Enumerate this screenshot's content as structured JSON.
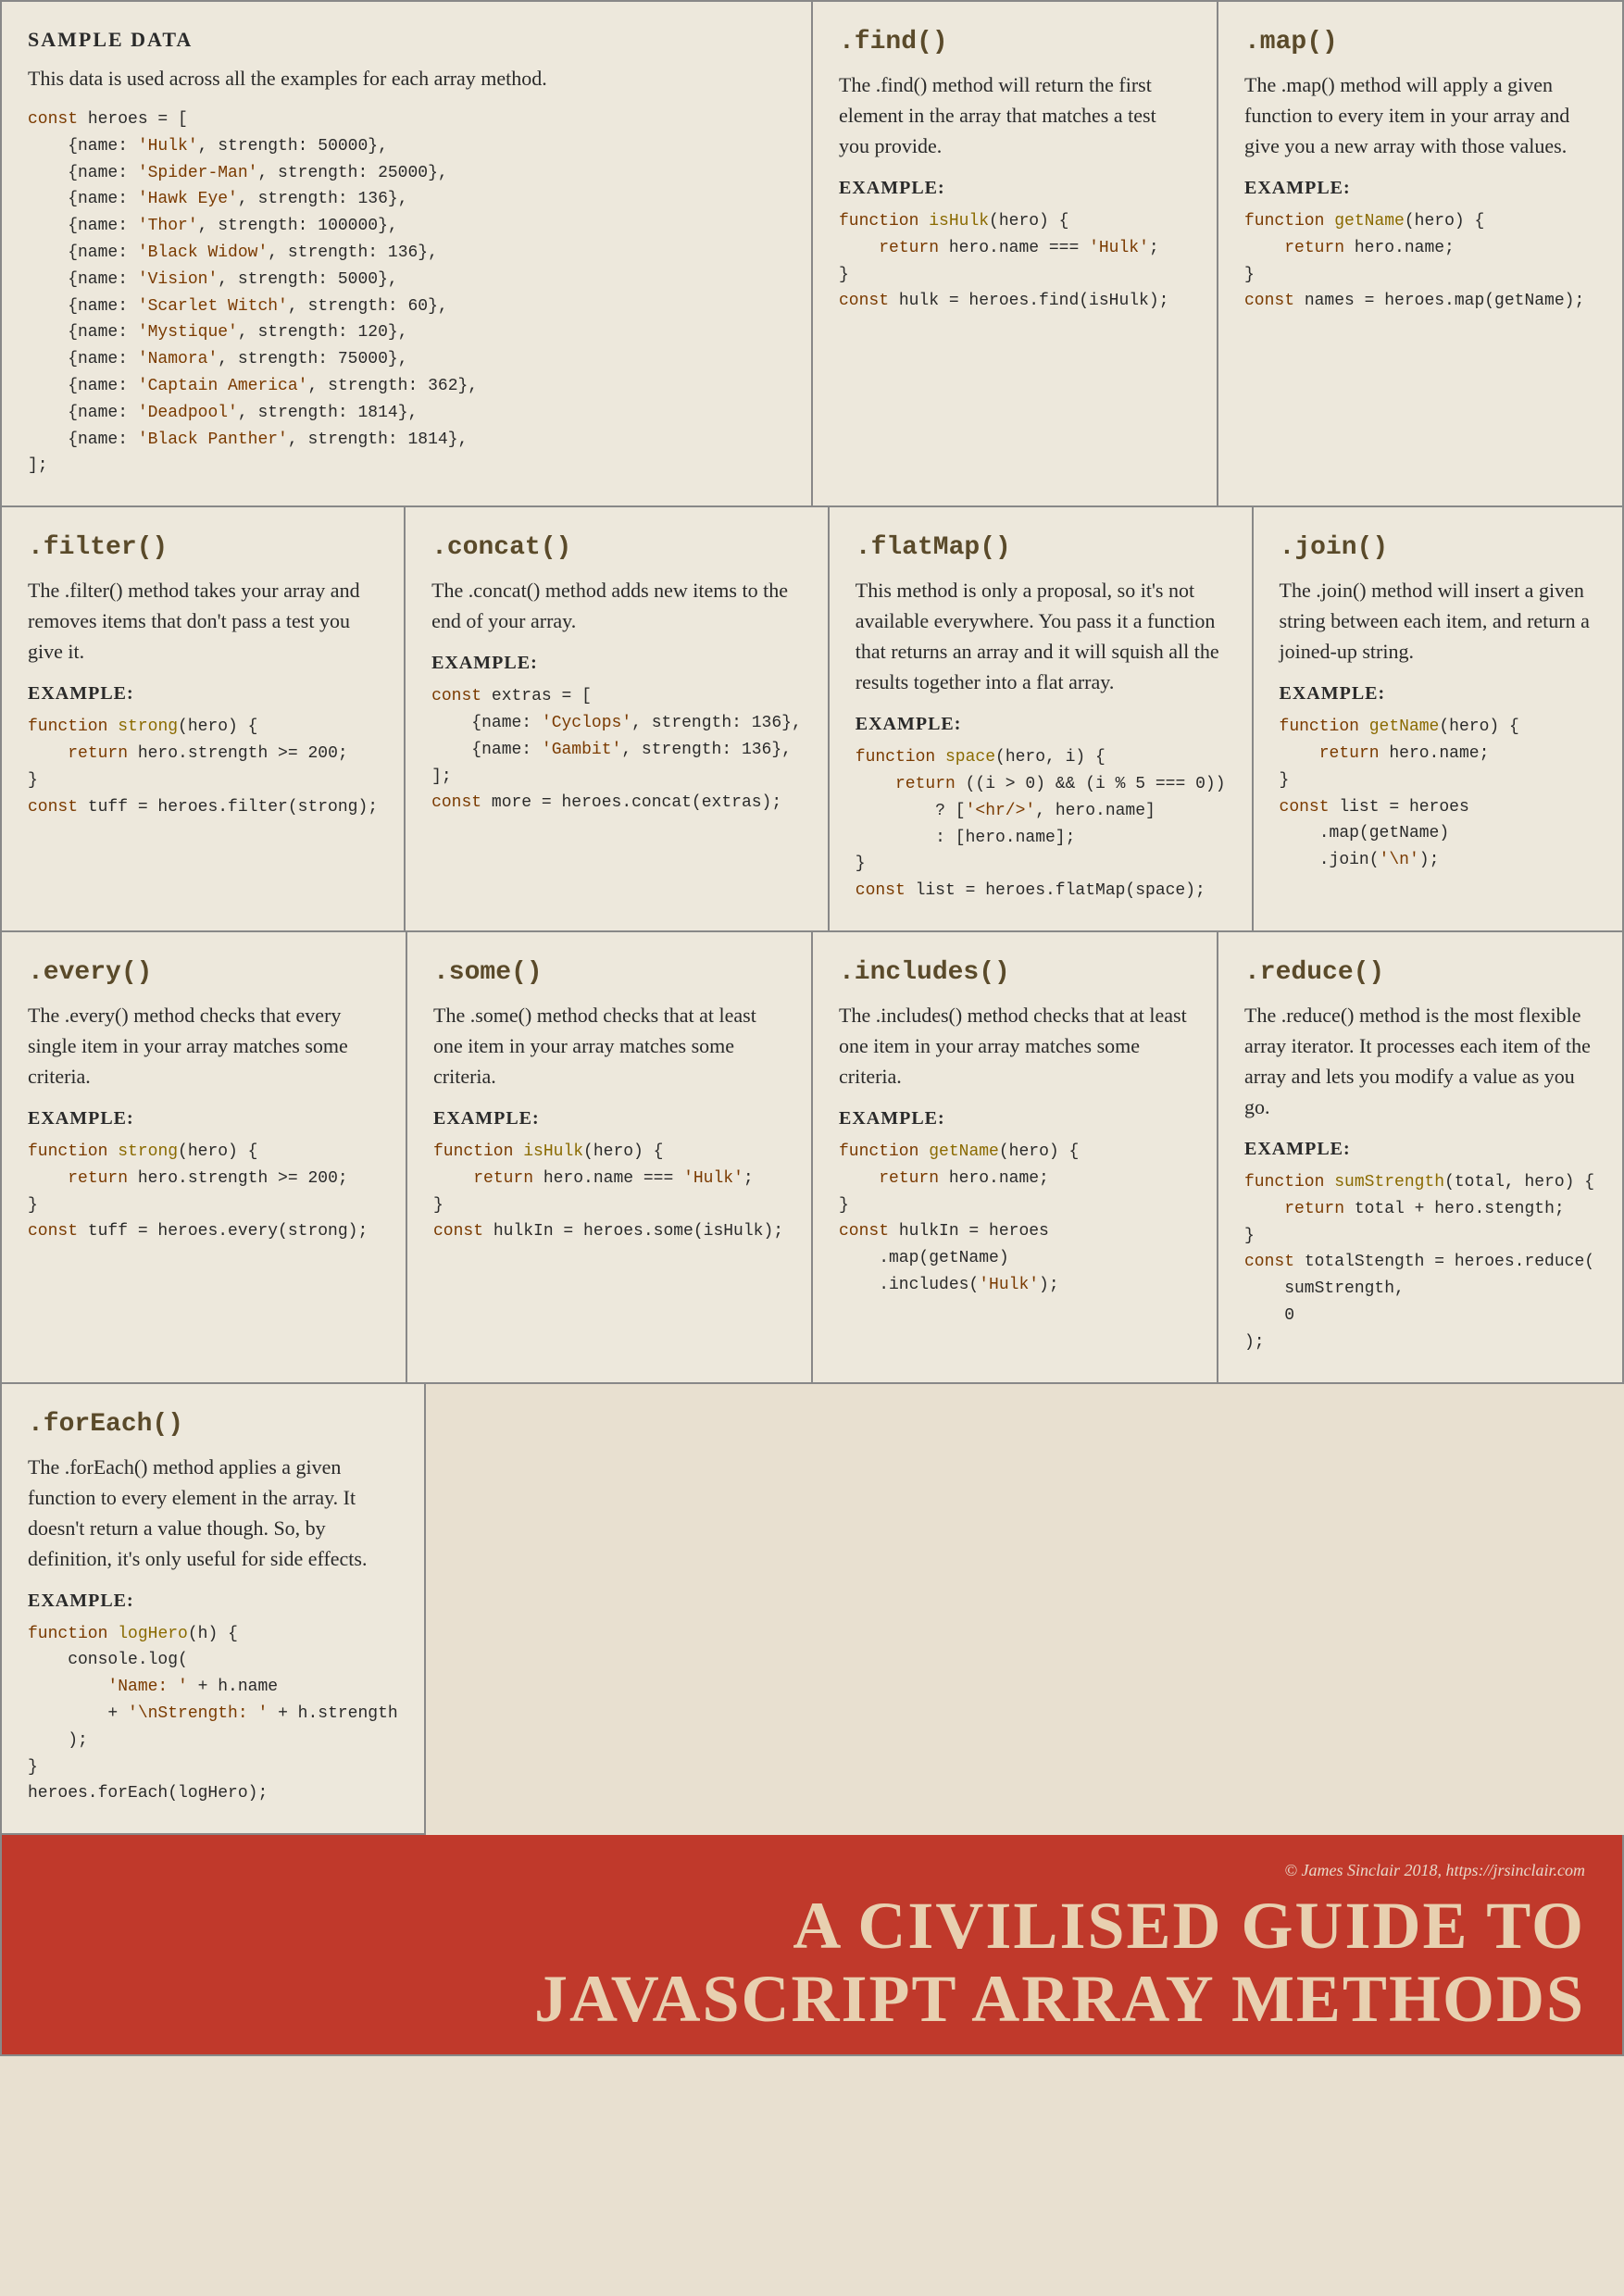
{
  "page": {
    "credit": "© James Sinclair 2018, https://jrsinclair.com",
    "main_title_line1": "A CIVILISED GUIDE TO",
    "main_title_line2": "JAVASCRIPT ARRAY METHODS"
  },
  "sample": {
    "title": "SAMPLE DATA",
    "description": "This data is used across all the examples for each array method.",
    "code": "const heroes = [\n    {name: 'Hulk', strength: 50000},\n    {name: 'Spider-Man', strength: 25000},\n    {name: 'Hawk Eye', strength: 136},\n    {name: 'Thor', strength: 100000},\n    {name: 'Black Widow', strength: 136},\n    {name: 'Vision', strength: 5000},\n    {name: 'Scarlet Witch', strength: 60},\n    {name: 'Mystique', strength: 120},\n    {name: 'Namora', strength: 75000},\n    {name: 'Captain America', strength: 362},\n    {name: 'Deadpool', strength: 1814},\n    {name: 'Black Panther', strength: 1814},\n];"
  },
  "find": {
    "title": ".find()",
    "description": "The .find() method will return the first element in the array that matches a test you provide.",
    "example_label": "EXAMPLE:",
    "code": "function isHulk(hero) {\n    return hero.name === 'Hulk';\n}\nconst hulk = heroes.find(isHulk);"
  },
  "map": {
    "title": ".map()",
    "description": "The .map() method will apply a given function to every item in your array and give you a new array with those values.",
    "example_label": "EXAMPLE:",
    "code": "function getName(hero) {\n    return hero.name;\n}\nconst names = heroes.map(getName);"
  },
  "filter": {
    "title": ".filter()",
    "description": "The .filter() method takes your array and removes items that don't pass a test you give it.",
    "example_label": "EXAMPLE:",
    "code": "function strong(hero) {\n    return hero.strength >= 200;\n}\nconst tuff = heroes.filter(strong);"
  },
  "concat": {
    "title": ".concat()",
    "description": "The .concat() method adds new items to the end of your array.",
    "example_label": "EXAMPLE:",
    "code": "const extras = [\n    {name: 'Cyclops', strength: 136},\n    {name: 'Gambit', strength: 136},\n];\nconst more = heroes.concat(extras);"
  },
  "flatmap": {
    "title": ".flatMap()",
    "description": "This method is only a proposal, so it's not available everywhere. You pass it a function that returns an array and it will squish all the results together into a flat array.",
    "example_label": "EXAMPLE:",
    "code": "function space(hero, i) {\n    return ((i > 0) && (i % 5 === 0))\n        ? ['<hr/>', hero.name]\n        : [hero.name];\n}\nconst list = heroes.flatMap(space);"
  },
  "join": {
    "title": ".join()",
    "description": "The .join() method will insert a given string between each item, and return a joined-up string.",
    "example_label": "EXAMPLE:",
    "code": "function getName(hero) {\n    return hero.name;\n}\nconst list = heroes\n    .map(getName)\n    .join('\\n');"
  },
  "every": {
    "title": ".every()",
    "description": "The .every() method checks that every single item in your array matches some criteria.",
    "example_label": "EXAMPLE:",
    "code": "function strong(hero) {\n    return hero.strength >= 200;\n}\nconst tuff = heroes.every(strong);"
  },
  "some": {
    "title": ".some()",
    "description": "The .some() method checks that at least one item in your array matches some criteria.",
    "example_label": "EXAMPLE:",
    "code": "function isHulk(hero) {\n    return hero.name === 'Hulk';\n}\nconst hulkIn = heroes.some(isHulk);"
  },
  "includes": {
    "title": ".includes()",
    "description": "The .includes() method checks that at least one item in your array matches some criteria.",
    "example_label": "EXAMPLE:",
    "code": "function getName(hero) {\n    return hero.name;\n}\nconst hulkIn = heroes\n    .map(getName)\n    .includes('Hulk');"
  },
  "reduce": {
    "title": ".reduce()",
    "description": "The .reduce() method is the most flexible array iterator. It processes each item of the array and lets you modify a value as you go.",
    "example_label": "EXAMPLE:",
    "code": "function sumStrength(total, hero) {\n    return total + hero.stength;\n}\nconst totalStength = heroes.reduce(\n    sumStrength,\n    0\n);"
  },
  "foreach": {
    "title": ".forEach()",
    "description": "The .forEach() method applies a given function to every element in the array. It doesn't return a value though. So, by definition, it's only useful for side effects.",
    "example_label": "EXAMPLE:",
    "code": "function logHero(h) {\n    console.log(\n        'Name: ' + h.name\n        + '\\nStrength: ' + h.strength\n    );\n}\nheroes.forEach(logHero);"
  }
}
